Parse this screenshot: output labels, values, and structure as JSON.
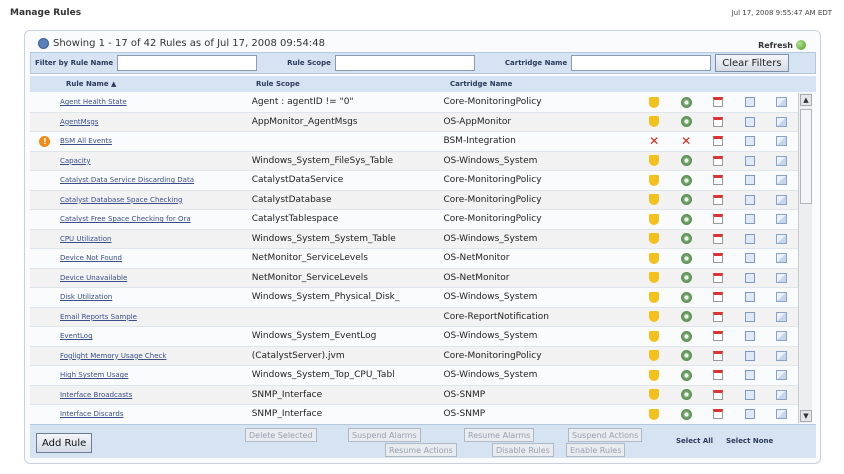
{
  "header": {
    "title": "Manage Rules",
    "timestamp": "Jul 17, 2008 9:55:47 AM EDT"
  },
  "summary": {
    "text": "Showing 1 - 17  of 42 Rules as of Jul 17, 2008 09:54:48",
    "refresh_label": "Refresh"
  },
  "filters": {
    "name_label": "Filter by Rule Name",
    "scope_label": "Rule Scope",
    "cartridge_label": "Cartridge Name",
    "clear_label": "Clear Filters"
  },
  "columns": {
    "name": "Rule Name ▲",
    "scope": "Rule Scope",
    "cartridge": "Cartridge Name"
  },
  "rows": [
    {
      "name": "Agent Health State",
      "scope": "Agent : agentID != \"0\"",
      "cartridge": "Core-MonitoringPolicy",
      "warning": false,
      "disabled": false
    },
    {
      "name": "AgentMsgs",
      "scope": "AppMonitor_AgentMsgs",
      "cartridge": "OS-AppMonitor",
      "warning": false,
      "disabled": false
    },
    {
      "name": "BSM All Events",
      "scope": "",
      "cartridge": "BSM-Integration",
      "warning": true,
      "disabled": true
    },
    {
      "name": "Capacity",
      "scope": "Windows_System_FileSys_Table",
      "cartridge": "OS-Windows_System",
      "warning": false,
      "disabled": false
    },
    {
      "name": "Catalyst Data Service Discarding Data",
      "scope": "CatalystDataService",
      "cartridge": "Core-MonitoringPolicy",
      "warning": false,
      "disabled": false
    },
    {
      "name": "Catalyst Database Space Checking",
      "scope": "CatalystDatabase",
      "cartridge": "Core-MonitoringPolicy",
      "warning": false,
      "disabled": false
    },
    {
      "name": "Catalyst Free Space Checking for Ora",
      "scope": "CatalystTablespace",
      "cartridge": "Core-MonitoringPolicy",
      "warning": false,
      "disabled": false
    },
    {
      "name": "CPU Utilization",
      "scope": "Windows_System_System_Table",
      "cartridge": "OS-Windows_System",
      "warning": false,
      "disabled": false
    },
    {
      "name": "Device Not Found",
      "scope": "NetMonitor_ServiceLevels",
      "cartridge": "OS-NetMonitor",
      "warning": false,
      "disabled": false
    },
    {
      "name": "Device Unavailable",
      "scope": "NetMonitor_ServiceLevels",
      "cartridge": "OS-NetMonitor",
      "warning": false,
      "disabled": false
    },
    {
      "name": "Disk Utilization",
      "scope": "Windows_System_Physical_Disk_",
      "cartridge": "OS-Windows_System",
      "warning": false,
      "disabled": false
    },
    {
      "name": "Email Reports Sample",
      "scope": "",
      "cartridge": "Core-ReportNotification",
      "warning": false,
      "disabled": false
    },
    {
      "name": "EventLog",
      "scope": "Windows_System_EventLog",
      "cartridge": "OS-Windows_System",
      "warning": false,
      "disabled": false
    },
    {
      "name": "Foglight Memory Usage Check",
      "scope": "(CatalystServer).jvm",
      "cartridge": "Core-MonitoringPolicy",
      "warning": false,
      "disabled": false
    },
    {
      "name": "High System Usage",
      "scope": "Windows_System_Top_CPU_Tabl",
      "cartridge": "OS-Windows_System",
      "warning": false,
      "disabled": false
    },
    {
      "name": "Interface Broadcasts",
      "scope": "SNMP_Interface",
      "cartridge": "OS-SNMP",
      "warning": false,
      "disabled": false
    },
    {
      "name": "Interface Discards",
      "scope": "SNMP_Interface",
      "cartridge": "OS-SNMP",
      "warning": false,
      "disabled": false
    }
  ],
  "actions": {
    "add_rule": "Add Rule",
    "delete_selected": "Delete Selected",
    "suspend_alarms": "Suspend Alarms",
    "resume_alarms": "Resume Alarms",
    "suspend_actions": "Suspend Actions",
    "resume_actions": "Resume Actions",
    "disable_rules": "Disable Rules",
    "enable_rules": "Enable Rules",
    "select_all": "Select All",
    "select_none": "Select None"
  },
  "colors": {
    "header_bg": "#d6e3f3",
    "link": "#3a4f8a",
    "warning": "#f08a18",
    "disabled_x": "#e02222"
  },
  "icons": [
    "edit-shield-icon",
    "gear-icon",
    "calendar-icon",
    "document-icon",
    "copy-icon"
  ]
}
